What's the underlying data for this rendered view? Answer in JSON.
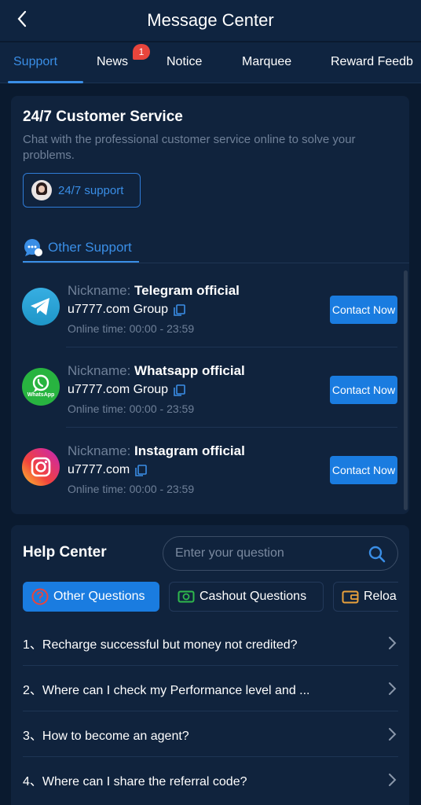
{
  "header": {
    "title": "Message Center"
  },
  "tabs": [
    {
      "label": "Support"
    },
    {
      "label": "News",
      "badge": "1"
    },
    {
      "label": "Notice"
    },
    {
      "label": "Marquee"
    },
    {
      "label": "Reward Feedb"
    }
  ],
  "customer_service": {
    "title": "24/7 Customer Service",
    "description": "Chat with the professional customer service online to solve your problems.",
    "button_label": "24/7 support"
  },
  "other_support": {
    "label": "Other Support",
    "contacts": [
      {
        "nickname_label": "Nickname:",
        "nickname": "Telegram official",
        "group": "u7777.com Group",
        "time_label": "Online time:",
        "time": "00:00 - 23:59",
        "button": "Contact Now",
        "icon": "telegram-icon"
      },
      {
        "nickname_label": "Nickname:",
        "nickname": "Whatsapp official",
        "group": "u7777.com Group",
        "time_label": "Online time:",
        "time": "00:00 - 23:59",
        "button": "Contact Now",
        "icon": "whatsapp-icon",
        "icon_text": "WhatsApp"
      },
      {
        "nickname_label": "Nickname:",
        "nickname": "Instagram official",
        "group": "u7777.com",
        "time_label": "Online time:",
        "time": "00:00 - 23:59",
        "button": "Contact Now",
        "icon": "instagram-icon"
      }
    ]
  },
  "help_center": {
    "title": "Help Center",
    "search_placeholder": "Enter your question",
    "categories": [
      {
        "label": "Other Questions",
        "active": true
      },
      {
        "label": "Cashout Questions",
        "active": false
      },
      {
        "label": "Reloa",
        "active": false
      }
    ],
    "questions": [
      {
        "num": "1、",
        "text": "Recharge successful but money not credited?"
      },
      {
        "num": "2、",
        "text": "Where can I check my Performance level and ..."
      },
      {
        "num": "3、",
        "text": "How to become an agent?"
      },
      {
        "num": "4、",
        "text": "Where can I share the referral code?"
      }
    ]
  },
  "colors": {
    "accent": "#1a7ce0",
    "background": "#0a1a2f",
    "card": "#10233d",
    "badge": "#e8453c"
  }
}
